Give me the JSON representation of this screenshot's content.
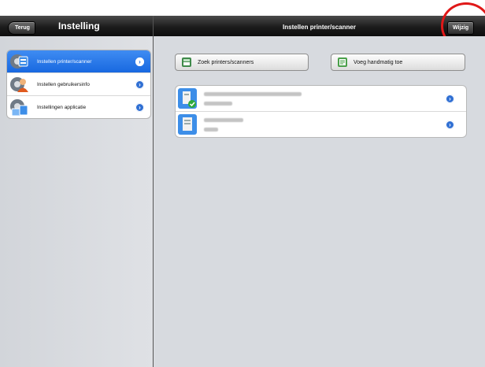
{
  "left_header": {
    "back_label": "Terug",
    "title": "Instelling"
  },
  "right_header": {
    "title": "Instellen printer/scanner",
    "edit_label": "Wijzig"
  },
  "menu": {
    "items": [
      {
        "label": "Instellen printer/scanner",
        "selected": true,
        "icon": "printer-settings-icon"
      },
      {
        "label": "Instellen gebruikersinfo",
        "selected": false,
        "icon": "user-settings-icon"
      },
      {
        "label": "Instellingen applicatie",
        "selected": false,
        "icon": "app-settings-icon"
      }
    ]
  },
  "actions": {
    "search_label": "Zoek printers/scanners",
    "add_label": "Voeg handmatig toe"
  },
  "printers": [
    {
      "icon": "printer-connected-icon",
      "status": "connected"
    },
    {
      "icon": "printer-icon",
      "status": ""
    }
  ],
  "colors": {
    "selected": "#1868e0",
    "annotation": "#e01818",
    "accent": "#2f6fd3"
  }
}
